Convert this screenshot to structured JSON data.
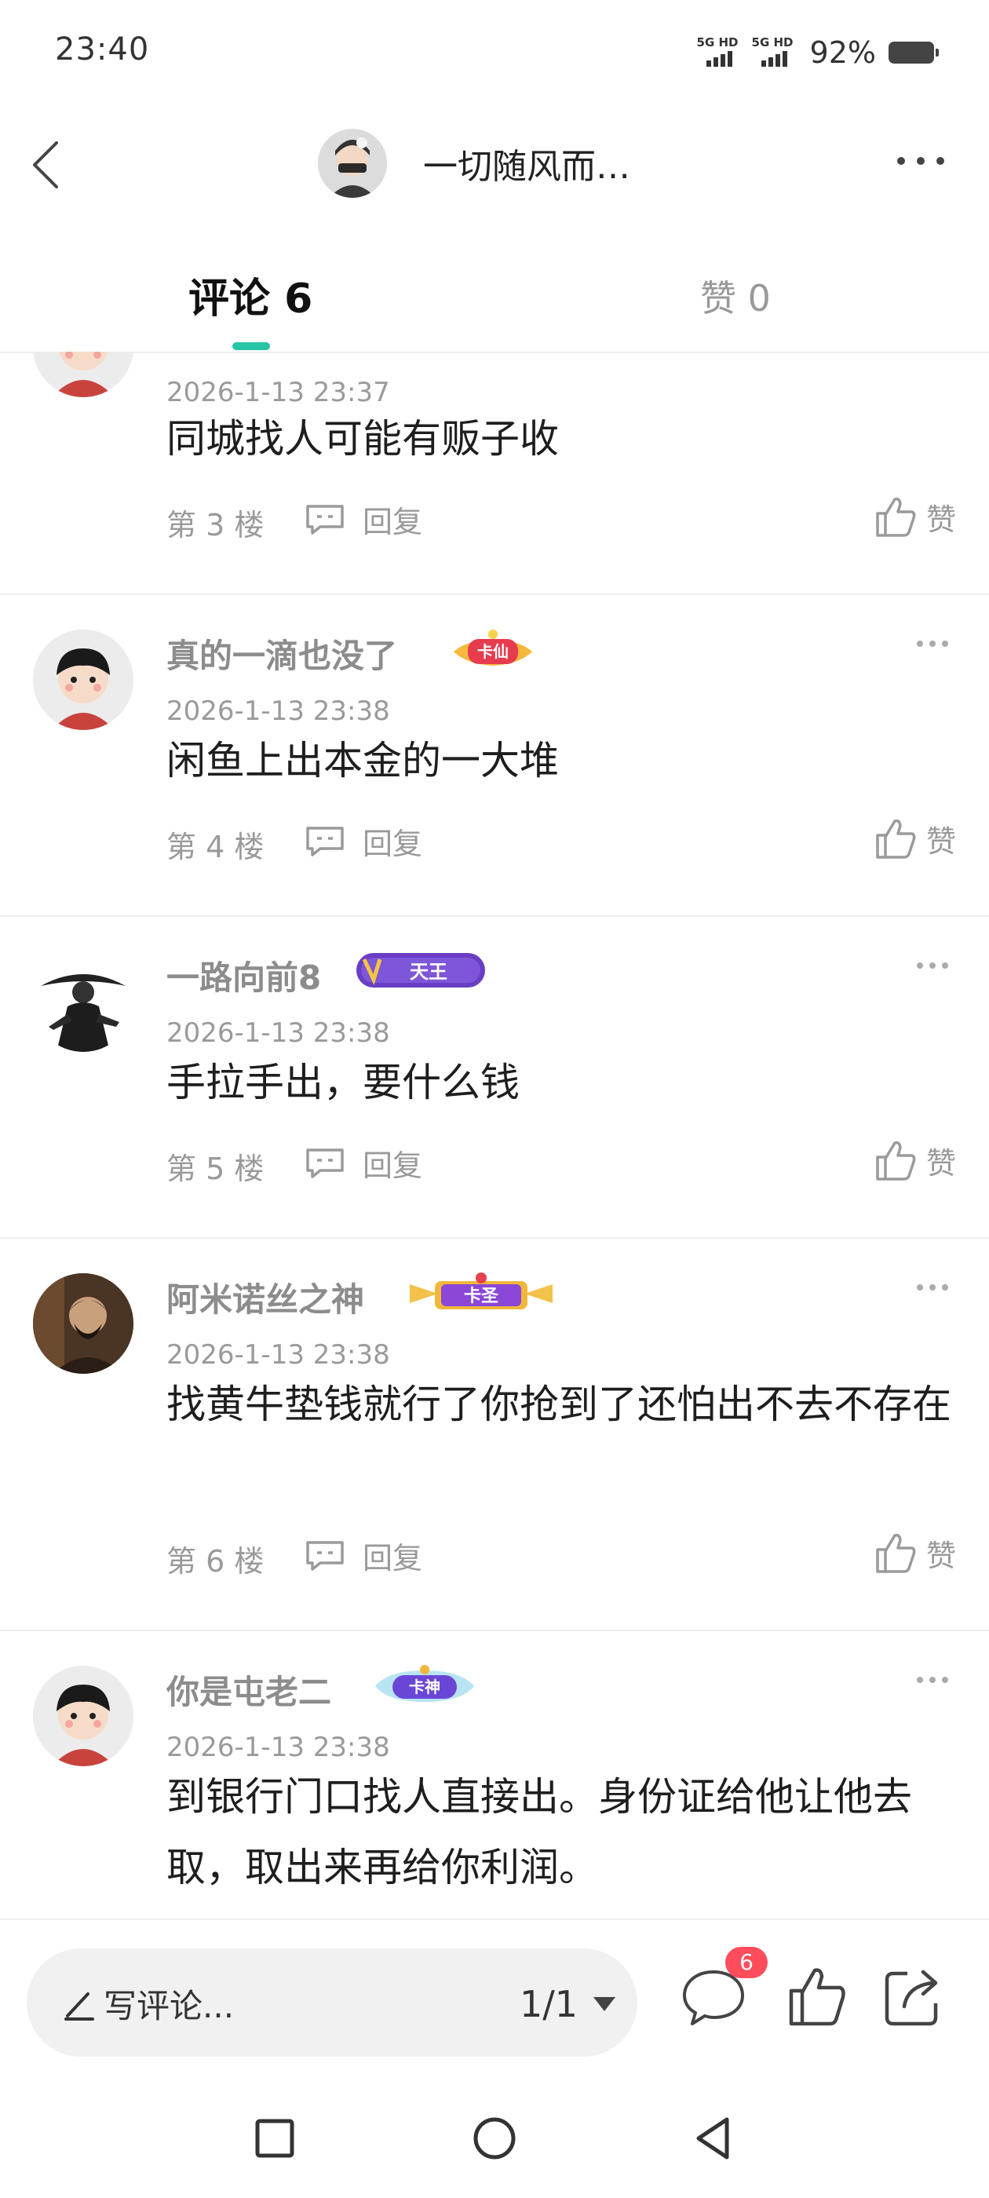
{
  "status_bar": {
    "time": "23:40",
    "signal1_label": "5G HD",
    "signal2_label": "5G HD",
    "battery": "92%"
  },
  "header": {
    "title": "一切随风而…",
    "back_icon": "chevron-left-icon",
    "more_icon": "more-horizontal-icon"
  },
  "tabs": {
    "comments": "评论 6",
    "likes": "赞 0"
  },
  "comments": [
    {
      "name": "",
      "badge": "",
      "time": "2026-1-13 23:37",
      "text": "同城找人可能有贩子收",
      "floor": "第 3 楼",
      "reply": "回复",
      "like": "赞"
    },
    {
      "name": "真的一滴也没了",
      "badge": "卡仙",
      "time": "2026-1-13 23:38",
      "text": "闲鱼上出本金的一大堆",
      "floor": "第 4 楼",
      "reply": "回复",
      "like": "赞"
    },
    {
      "name": "一路向前8",
      "badge": "天王",
      "time": "2026-1-13 23:38",
      "text": "手拉手出，要什么钱",
      "floor": "第 5 楼",
      "reply": "回复",
      "like": "赞"
    },
    {
      "name": "阿米诺丝之神",
      "badge": "卡圣",
      "time": "2026-1-13 23:38",
      "text": "找黄牛垫钱就行了你抢到了还怕出不去不存在",
      "floor": "第 6 楼",
      "reply": "回复",
      "like": "赞"
    },
    {
      "name": "你是屯老二",
      "badge": "卡神",
      "time": "2026-1-13 23:38",
      "text": "到银行门口找人直接出。身份证给他让他去取，取出来再给你利润。",
      "floor": "",
      "reply": "",
      "like": ""
    }
  ],
  "bottom_bar": {
    "input_placeholder": "写评论...",
    "page_indicator": "1/1",
    "comment_count": "6",
    "icons": [
      "comment-icon",
      "thumbs-up-icon",
      "share-icon"
    ]
  },
  "colors": {
    "accent": "#28c4a6",
    "badge_red": "#ff4d5b",
    "muted_text": "#9a9a9a"
  }
}
